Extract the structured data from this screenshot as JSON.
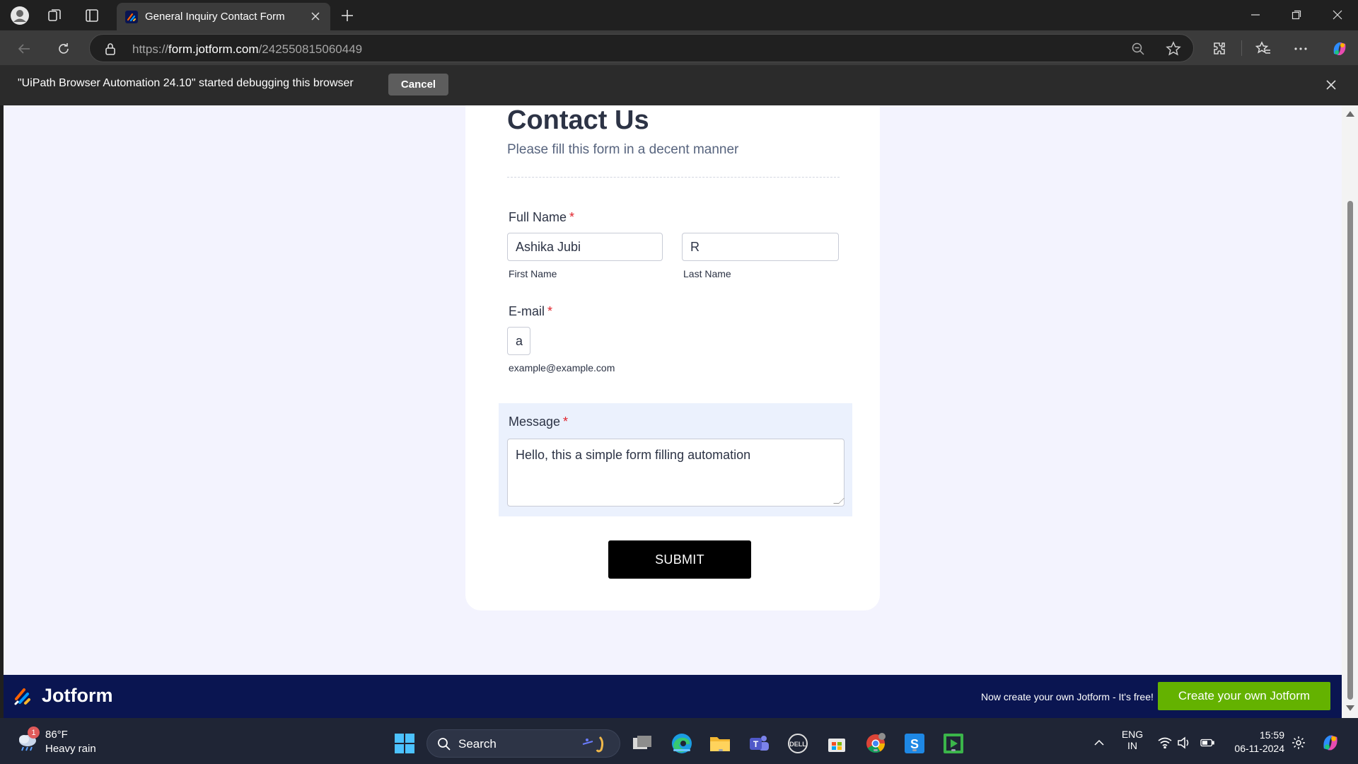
{
  "browser": {
    "tab_title": "General Inquiry Contact Form",
    "url_prefix": "https://",
    "url_host": "form.jotform.com",
    "url_path": "/242550815060449"
  },
  "infobar": {
    "message": "\"UiPath Browser Automation 24.10\" started debugging this browser",
    "cancel_label": "Cancel"
  },
  "form": {
    "title": "Contact Us",
    "subtitle": "Please fill this form in a decent manner",
    "full_name": {
      "label": "Full Name",
      "required": "*",
      "first_value": "Ashika Jubi",
      "first_sublabel": "First Name",
      "last_value": "R",
      "last_sublabel": "Last Name"
    },
    "email": {
      "label": "E-mail",
      "required": "*",
      "value": "a",
      "sublabel": "example@example.com"
    },
    "message": {
      "label": "Message",
      "required": "*",
      "value": "Hello, this a simple form filling automation"
    },
    "submit_label": "SUBMIT"
  },
  "footer": {
    "brand": "Jotform",
    "promo": "Now create your own Jotform - It's free!",
    "cta_label": "Create your own Jotform"
  },
  "taskbar": {
    "weather_temp": "86°F",
    "weather_desc": "Heavy rain",
    "weather_badge": "1",
    "search_label": "Search",
    "lang_top": "ENG",
    "lang_bottom": "IN",
    "time": "15:59",
    "date": "06-11-2024"
  },
  "colors": {
    "page_bg": "#f3f3fe",
    "footer_bg": "#0a1551",
    "cta_green": "#64b200",
    "required_red": "#e0242c",
    "message_highlight": "#ebf1fd"
  }
}
